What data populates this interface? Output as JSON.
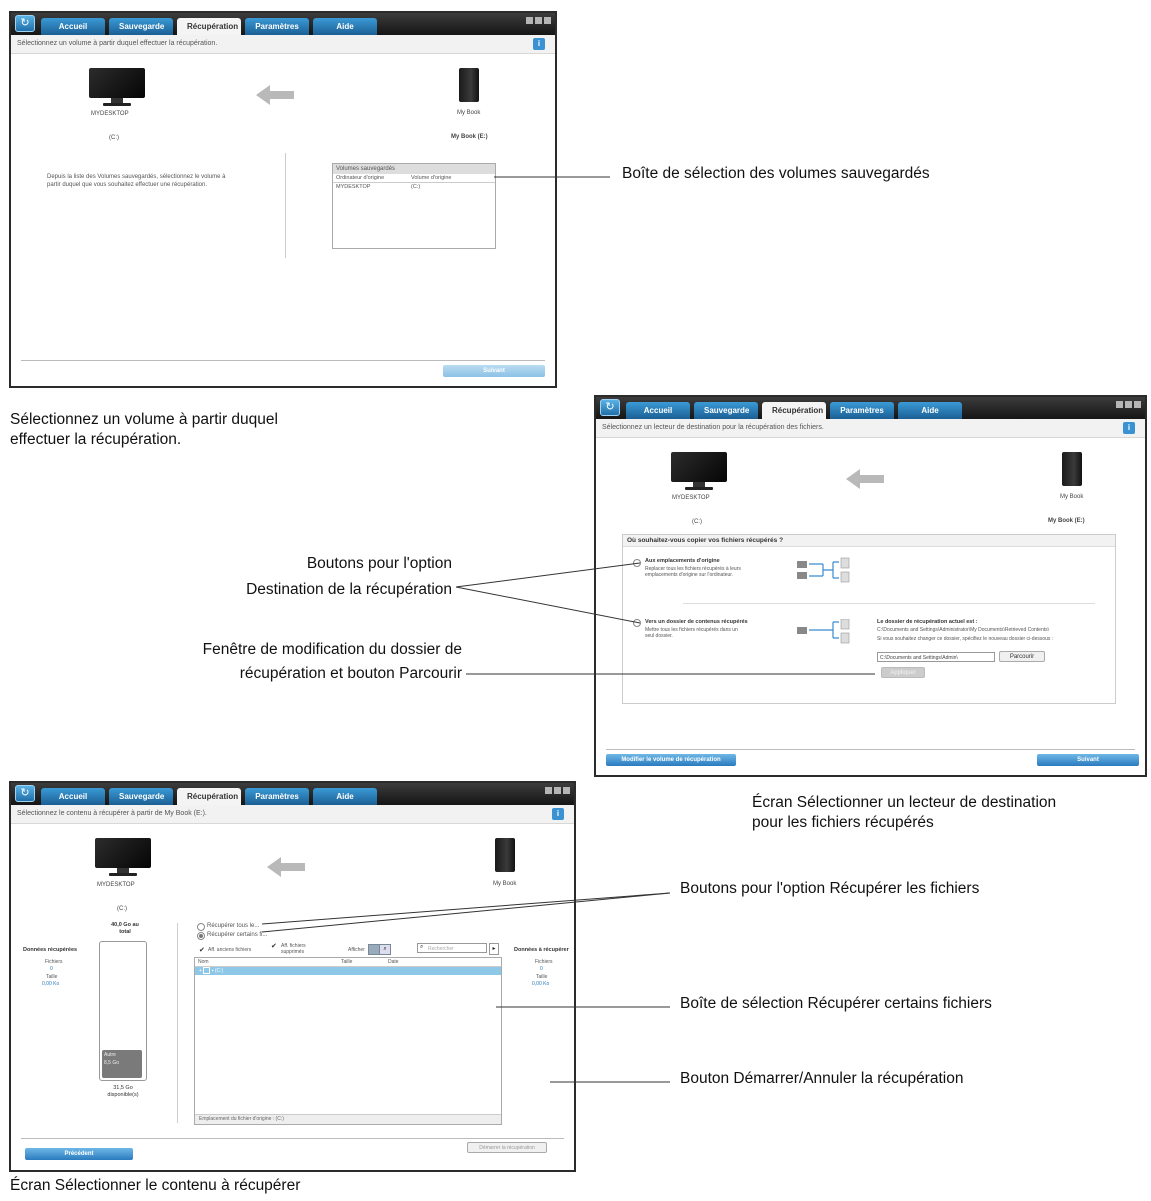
{
  "app": {
    "tabs": [
      "Accueil",
      "Sauvegarde",
      "Récupération",
      "Paramètres",
      "Aide"
    ],
    "info_icon": "info-icon"
  },
  "screen1": {
    "subtitle": "Sélectionnez un volume à partir duquel effectuer la récupération.",
    "computer_name": "MYDESKTOP",
    "computer_drive": "(C:)",
    "device_name": "My Book",
    "device_drive": "My Book (E:)",
    "instructions": "Depuis la liste des Volumes sauvegardés, sélectionnez le volume à partir duquel que vous souhaitez effectuer une récupération.",
    "volumes_title": "Volumes sauvegardés",
    "volumes_columns": [
      "Ordinateur d'origine",
      "Volume d'origine"
    ],
    "volumes_rows": [
      [
        "MYDESKTOP",
        "(C:)"
      ]
    ],
    "next_button": "Suivant"
  },
  "screen2": {
    "subtitle": "Sélectionnez un lecteur de destination pour la récupération des fichiers.",
    "computer_name": "MYDESKTOP",
    "computer_drive": "(C:)",
    "device_name": "My Book",
    "device_drive": "My Book (E:)",
    "question": "Où souhaitez-vous copier vos fichiers récupérés ?",
    "option1_title": "Aux emplacements d'origine",
    "option1_desc": "Replacer tous les fichiers récupérés à leurs emplacements d'origine sur l'ordinateur.",
    "option2_title": "Vers un dossier de contenus récupérés",
    "option2_desc": "Mettre tous les fichiers récupérés dans un seul dossier.",
    "folder_label": "Le dossier de récupération actuel est :",
    "folder_path": "C:\\Documents and Settings\\Administrator\\My Documents\\Retrieved Contents\\",
    "change_hint": "Si vous souhaitez changer ce dossier, spécifiez le nouveau dossier ci-dessous :",
    "folder_input": "C:\\Documents and Settings\\Admin\\",
    "browse_button": "Parcourir",
    "apply_button": "Appliquer",
    "back_button": "Modifier le volume de récupération",
    "next_button": "Suivant"
  },
  "screen3": {
    "subtitle": "Sélectionnez le contenu à récupérer à partir de My Book (E:).",
    "computer_name": "MYDESKTOP",
    "computer_drive": "(C:)",
    "device_name": "My Book",
    "total": "40,0 Go au total",
    "left_heading": "Données récupérées",
    "left_files_label": "Fichiers",
    "left_files_value": "0",
    "left_size_label": "Taille",
    "left_size_value": "0,00 Ko",
    "used_label": "Autre",
    "used_value": "8,5 Go",
    "available": "31,5 Go disponible(s)",
    "radio_all": "Récupérer tous le...",
    "radio_some": "Récupérer certains fi...",
    "chk_old": "Aff. anciens fichiers",
    "chk_deleted": "Aff. fichiers supprimés",
    "show_label": "Afficher",
    "search_placeholder": "Rechercher",
    "columns": [
      "Nom",
      "Taille",
      "Date"
    ],
    "tree_row": "(C:)",
    "footer_path": "Emplacement du fichier d'origine : (C:)",
    "right_heading": "Données à récupérer",
    "right_files_label": "Fichiers",
    "right_files_value": "0",
    "right_size_label": "Taille",
    "right_size_value": "0,00 Ko",
    "start_button": "Démarrer la récupération",
    "back_button": "Précédent"
  },
  "annotations": {
    "a1": "Boîte de sélection des volumes sauvegardés",
    "a2_line1": "Boutons pour l'option",
    "a2_line2": "Destination de la récupération",
    "a3_line1": "Fenêtre de modification du dossier de",
    "a3_line2": "récupération et bouton Parcourir",
    "a4": "Boutons pour l'option Récupérer les fichiers",
    "a5": "Boîte de sélection Récupérer certains fichiers",
    "a6": "Bouton Démarrer/Annuler la récupération"
  },
  "captions": {
    "c1_line1": "Sélectionnez un volume à partir duquel",
    "c1_line2": "effectuer la récupération.",
    "c2_line1": "Écran Sélectionner un lecteur de destination",
    "c2_line2": "pour les fichiers récupérés",
    "c3": "Écran Sélectionner le contenu à récupérer"
  },
  "colors": {
    "tab_blue": "#2a7bbf",
    "chrome_dark": "#1e1e1e",
    "selection_blue": "#8ec8e8"
  }
}
